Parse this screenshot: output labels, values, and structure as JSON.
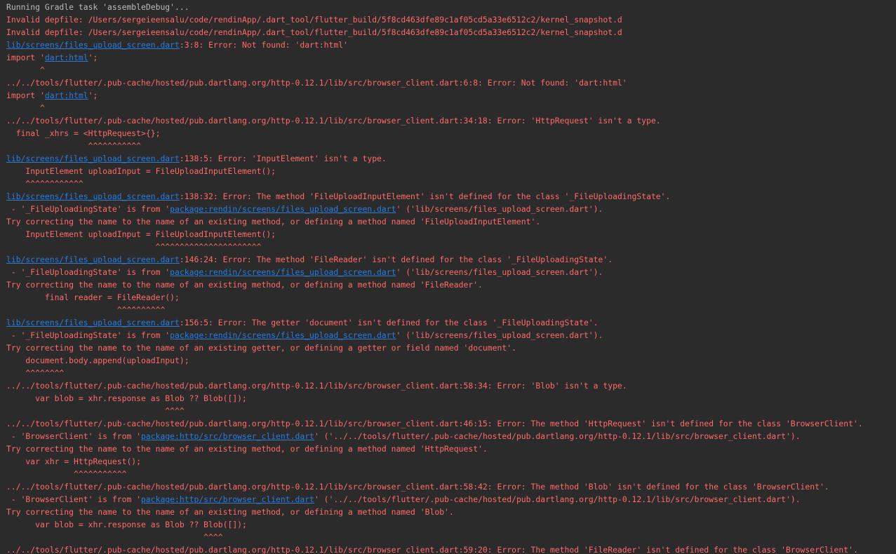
{
  "colors": {
    "background": "#2b2b2b",
    "error_text": "#ff6b68",
    "info_text": "#bbbbbb",
    "link": "#287bde"
  },
  "lines": [
    {
      "type": "info",
      "segments": [
        {
          "text": "Running Gradle task 'assembleDebug'..."
        }
      ]
    },
    {
      "type": "error",
      "segments": [
        {
          "text": "Invalid depfile: /Users/sergeieensalu/code/rendinApp/.dart_tool/flutter_build/5f8cd463dfe89c1af05cd5a33e6512c2/kernel_snapshot.d"
        }
      ]
    },
    {
      "type": "error",
      "segments": [
        {
          "text": "Invalid depfile: /Users/sergeieensalu/code/rendinApp/.dart_tool/flutter_build/5f8cd463dfe89c1af05cd5a33e6512c2/kernel_snapshot.d"
        }
      ]
    },
    {
      "type": "error",
      "segments": [
        {
          "text": "lib/screens/files_upload_screen.dart",
          "link": true
        },
        {
          "text": ":3:8: Error: Not found: 'dart:html'"
        }
      ]
    },
    {
      "type": "error",
      "segments": [
        {
          "text": "import '"
        },
        {
          "text": "dart:html",
          "link": true
        },
        {
          "text": "';"
        }
      ]
    },
    {
      "type": "error",
      "segments": [
        {
          "text": "       ^"
        }
      ]
    },
    {
      "type": "error",
      "segments": [
        {
          "text": "../../tools/flutter/.pub-cache/hosted/pub.dartlang.org/http-0.12.1/lib/src/browser_client.dart:6:8: Error: Not found: 'dart:html'"
        }
      ]
    },
    {
      "type": "error",
      "segments": [
        {
          "text": "import '"
        },
        {
          "text": "dart:html",
          "link": true
        },
        {
          "text": "';"
        }
      ]
    },
    {
      "type": "error",
      "segments": [
        {
          "text": "       ^"
        }
      ]
    },
    {
      "type": "error",
      "segments": [
        {
          "text": "../../tools/flutter/.pub-cache/hosted/pub.dartlang.org/http-0.12.1/lib/src/browser_client.dart:34:18: Error: 'HttpRequest' isn't a type."
        }
      ]
    },
    {
      "type": "error",
      "segments": [
        {
          "text": "  final _xhrs = <HttpRequest>{};"
        }
      ]
    },
    {
      "type": "error",
      "segments": [
        {
          "text": "                 ^^^^^^^^^^^"
        }
      ]
    },
    {
      "type": "error",
      "segments": [
        {
          "text": "lib/screens/files_upload_screen.dart",
          "link": true
        },
        {
          "text": ":138:5: Error: 'InputElement' isn't a type."
        }
      ]
    },
    {
      "type": "error",
      "segments": [
        {
          "text": "    InputElement uploadInput = FileUploadInputElement();"
        }
      ]
    },
    {
      "type": "error",
      "segments": [
        {
          "text": "    ^^^^^^^^^^^^"
        }
      ]
    },
    {
      "type": "error",
      "segments": [
        {
          "text": "lib/screens/files_upload_screen.dart",
          "link": true
        },
        {
          "text": ":138:32: Error: The method 'FileUploadInputElement' isn't defined for the class '_FileUploadingState'."
        }
      ]
    },
    {
      "type": "error",
      "segments": [
        {
          "text": " - '_FileUploadingState' is from '"
        },
        {
          "text": "package:rendin/screens/files_upload_screen.dart",
          "link": true
        },
        {
          "text": "' ('lib/screens/files_upload_screen.dart')."
        }
      ]
    },
    {
      "type": "error",
      "segments": [
        {
          "text": "Try correcting the name to the name of an existing method, or defining a method named 'FileUploadInputElement'."
        }
      ]
    },
    {
      "type": "error",
      "segments": [
        {
          "text": "    InputElement uploadInput = FileUploadInputElement();"
        }
      ]
    },
    {
      "type": "error",
      "segments": [
        {
          "text": "                               ^^^^^^^^^^^^^^^^^^^^^^"
        }
      ]
    },
    {
      "type": "error",
      "segments": [
        {
          "text": "lib/screens/files_upload_screen.dart",
          "link": true
        },
        {
          "text": ":146:24: Error: The method 'FileReader' isn't defined for the class '_FileUploadingState'."
        }
      ]
    },
    {
      "type": "error",
      "segments": [
        {
          "text": " - '_FileUploadingState' is from '"
        },
        {
          "text": "package:rendin/screens/files_upload_screen.dart",
          "link": true
        },
        {
          "text": "' ('lib/screens/files_upload_screen.dart')."
        }
      ]
    },
    {
      "type": "error",
      "segments": [
        {
          "text": "Try correcting the name to the name of an existing method, or defining a method named 'FileReader'."
        }
      ]
    },
    {
      "type": "error",
      "segments": [
        {
          "text": "        final reader = FileReader();"
        }
      ]
    },
    {
      "type": "error",
      "segments": [
        {
          "text": "                       ^^^^^^^^^^"
        }
      ]
    },
    {
      "type": "error",
      "segments": [
        {
          "text": "lib/screens/files_upload_screen.dart",
          "link": true
        },
        {
          "text": ":156:5: Error: The getter 'document' isn't defined for the class '_FileUploadingState'."
        }
      ]
    },
    {
      "type": "error",
      "segments": [
        {
          "text": " - '_FileUploadingState' is from '"
        },
        {
          "text": "package:rendin/screens/files_upload_screen.dart",
          "link": true
        },
        {
          "text": "' ('lib/screens/files_upload_screen.dart')."
        }
      ]
    },
    {
      "type": "error",
      "segments": [
        {
          "text": "Try correcting the name to the name of an existing getter, or defining a getter or field named 'document'."
        }
      ]
    },
    {
      "type": "error",
      "segments": [
        {
          "text": "    document.body.append(uploadInput);"
        }
      ]
    },
    {
      "type": "error",
      "segments": [
        {
          "text": "    ^^^^^^^^"
        }
      ]
    },
    {
      "type": "error",
      "segments": [
        {
          "text": "../../tools/flutter/.pub-cache/hosted/pub.dartlang.org/http-0.12.1/lib/src/browser_client.dart:58:34: Error: 'Blob' isn't a type."
        }
      ]
    },
    {
      "type": "error",
      "segments": [
        {
          "text": "      var blob = xhr.response as Blob ?? Blob([]);"
        }
      ]
    },
    {
      "type": "error",
      "segments": [
        {
          "text": "                                 ^^^^"
        }
      ]
    },
    {
      "type": "error",
      "segments": [
        {
          "text": "../../tools/flutter/.pub-cache/hosted/pub.dartlang.org/http-0.12.1/lib/src/browser_client.dart:46:15: Error: The method 'HttpRequest' isn't defined for the class 'BrowserClient'."
        }
      ]
    },
    {
      "type": "error",
      "segments": [
        {
          "text": " - 'BrowserClient' is from '"
        },
        {
          "text": "package:http/src/browser_client.dart",
          "link": true
        },
        {
          "text": "' ('../../tools/flutter/.pub-cache/hosted/pub.dartlang.org/http-0.12.1/lib/src/browser_client.dart')."
        }
      ]
    },
    {
      "type": "error",
      "segments": [
        {
          "text": "Try correcting the name to the name of an existing method, or defining a method named 'HttpRequest'."
        }
      ]
    },
    {
      "type": "error",
      "segments": [
        {
          "text": "    var xhr = HttpRequest();"
        }
      ]
    },
    {
      "type": "error",
      "segments": [
        {
          "text": "              ^^^^^^^^^^^"
        }
      ]
    },
    {
      "type": "error",
      "segments": [
        {
          "text": "../../tools/flutter/.pub-cache/hosted/pub.dartlang.org/http-0.12.1/lib/src/browser_client.dart:58:42: Error: The method 'Blob' isn't defined for the class 'BrowserClient'."
        }
      ]
    },
    {
      "type": "error",
      "segments": [
        {
          "text": " - 'BrowserClient' is from '"
        },
        {
          "text": "package:http/src/browser_client.dart",
          "link": true
        },
        {
          "text": "' ('../../tools/flutter/.pub-cache/hosted/pub.dartlang.org/http-0.12.1/lib/src/browser_client.dart')."
        }
      ]
    },
    {
      "type": "error",
      "segments": [
        {
          "text": "Try correcting the name to the name of an existing method, or defining a method named 'Blob'."
        }
      ]
    },
    {
      "type": "error",
      "segments": [
        {
          "text": "      var blob = xhr.response as Blob ?? Blob([]);"
        }
      ]
    },
    {
      "type": "error",
      "segments": [
        {
          "text": "                                         ^^^^"
        }
      ]
    },
    {
      "type": "error",
      "segments": [
        {
          "text": "../../tools/flutter/.pub-cache/hosted/pub.dartlang.org/http-0.12.1/lib/src/browser_client.dart:59:20: Error: The method 'FileReader' isn't defined for the class 'BrowserClient'."
        }
      ]
    }
  ]
}
